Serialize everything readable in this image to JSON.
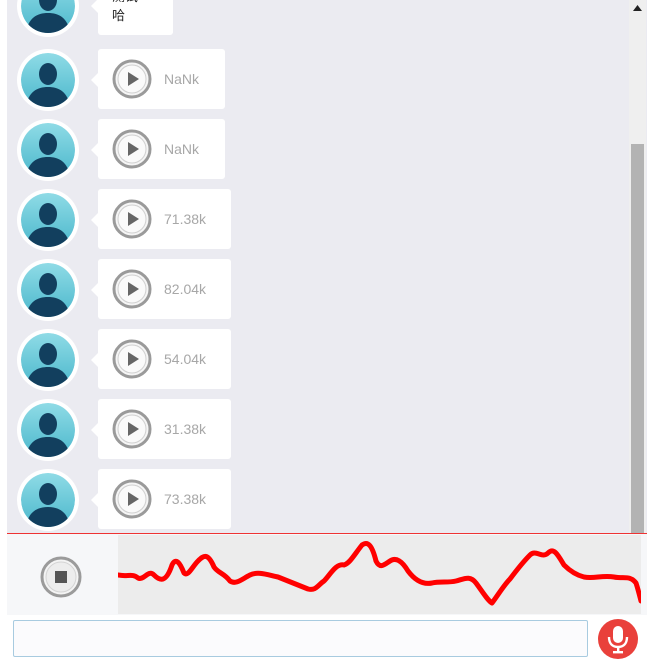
{
  "messages": [
    {
      "type": "text",
      "text": "测试一哈"
    },
    {
      "type": "voice",
      "duration": "NaNk"
    },
    {
      "type": "voice",
      "duration": "NaNk"
    },
    {
      "type": "voice",
      "duration": "71.38k"
    },
    {
      "type": "voice",
      "duration": "82.04k"
    },
    {
      "type": "voice",
      "duration": "54.04k"
    },
    {
      "type": "voice",
      "duration": "31.38k"
    },
    {
      "type": "voice",
      "duration": "73.38k"
    }
  ],
  "recorder": {
    "stop_icon": "stop-icon",
    "waveform_color": "#ff0000"
  },
  "input": {
    "value": "",
    "placeholder": ""
  },
  "colors": {
    "chat_bg": "#ebebf1",
    "mic_button": "#e9403b",
    "record_border": "#ee3333"
  }
}
